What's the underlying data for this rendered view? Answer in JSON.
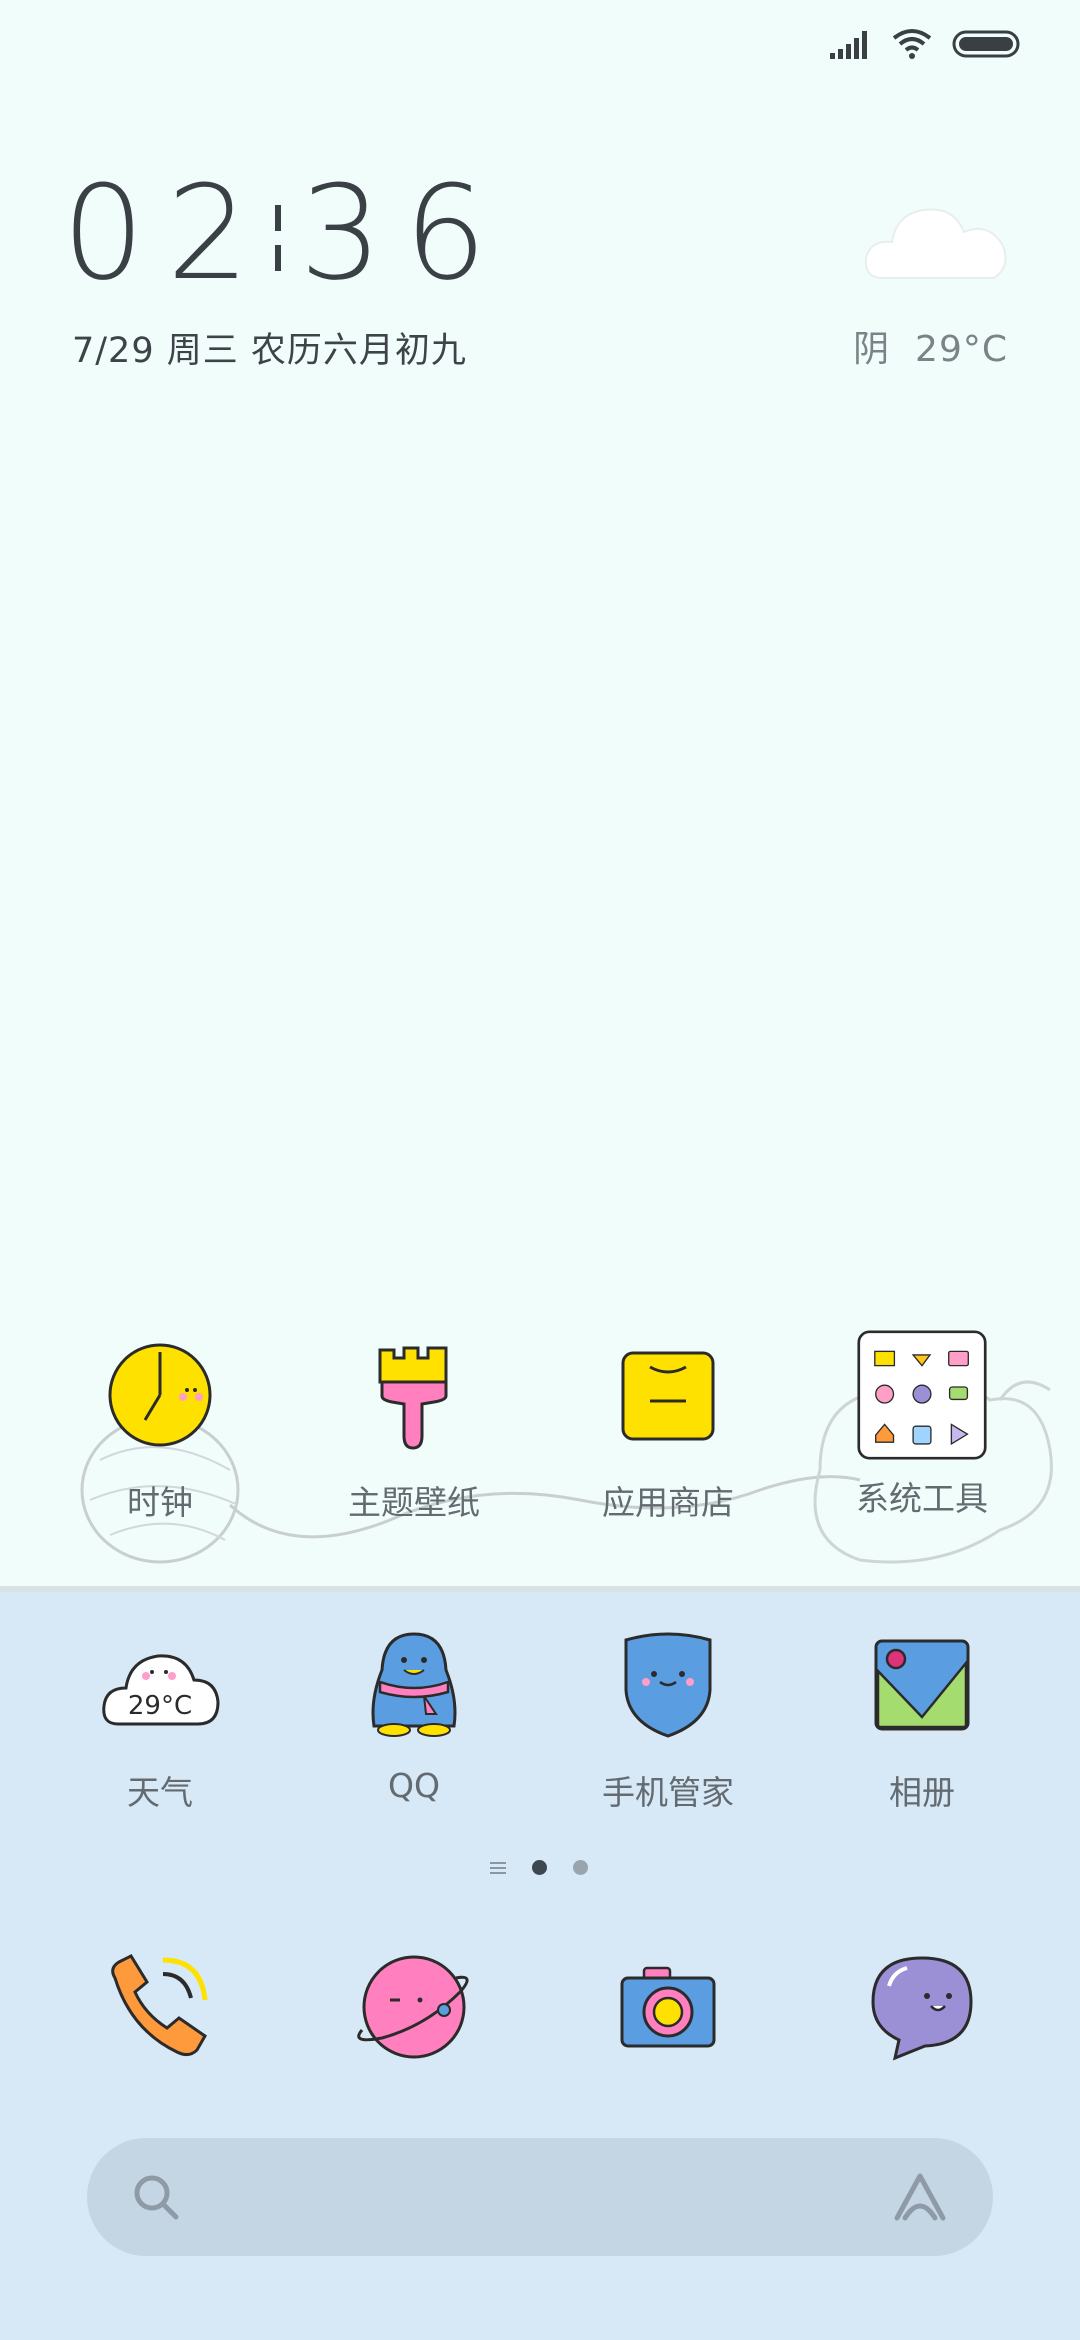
{
  "status_bar": {
    "signal_icon": "signal-icon",
    "wifi_icon": "wifi-icon",
    "battery_icon": "battery-icon"
  },
  "lockscreen": {
    "hour": "02",
    "minute": "36",
    "date": "7/29 周三 农历六月初九",
    "weather": {
      "condition": "阴",
      "temperature": "29°C",
      "icon": "cloud-icon"
    }
  },
  "home_row": [
    {
      "label": "时钟",
      "icon": "clock-icon"
    },
    {
      "label": "主题壁纸",
      "icon": "paintbrush-icon"
    },
    {
      "label": "应用商店",
      "icon": "app-store-bag-icon"
    },
    {
      "label": "系统工具",
      "icon": "folder-icon"
    }
  ],
  "second_row": [
    {
      "label": "天气",
      "icon": "weather-icon",
      "icon_text": "29°C"
    },
    {
      "label": "QQ",
      "icon": "qq-penguin-icon"
    },
    {
      "label": "手机管家",
      "icon": "shield-icon"
    },
    {
      "label": "相册",
      "icon": "gallery-icon"
    }
  ],
  "page_indicator": {
    "pages": 2,
    "active": 0
  },
  "dock": [
    {
      "icon": "phone-icon"
    },
    {
      "icon": "browser-planet-icon"
    },
    {
      "icon": "camera-icon"
    },
    {
      "icon": "messages-icon"
    }
  ],
  "search_bar": {
    "search_icon": "search-icon",
    "assistant_icon": "assistant-icon"
  },
  "colors": {
    "background": "#f1fdfb",
    "dock": "#d7e8f6",
    "search": "#c4d6e4",
    "yellow": "#ffe100",
    "pink": "#ff7fbf",
    "blue": "#5a9de0"
  }
}
